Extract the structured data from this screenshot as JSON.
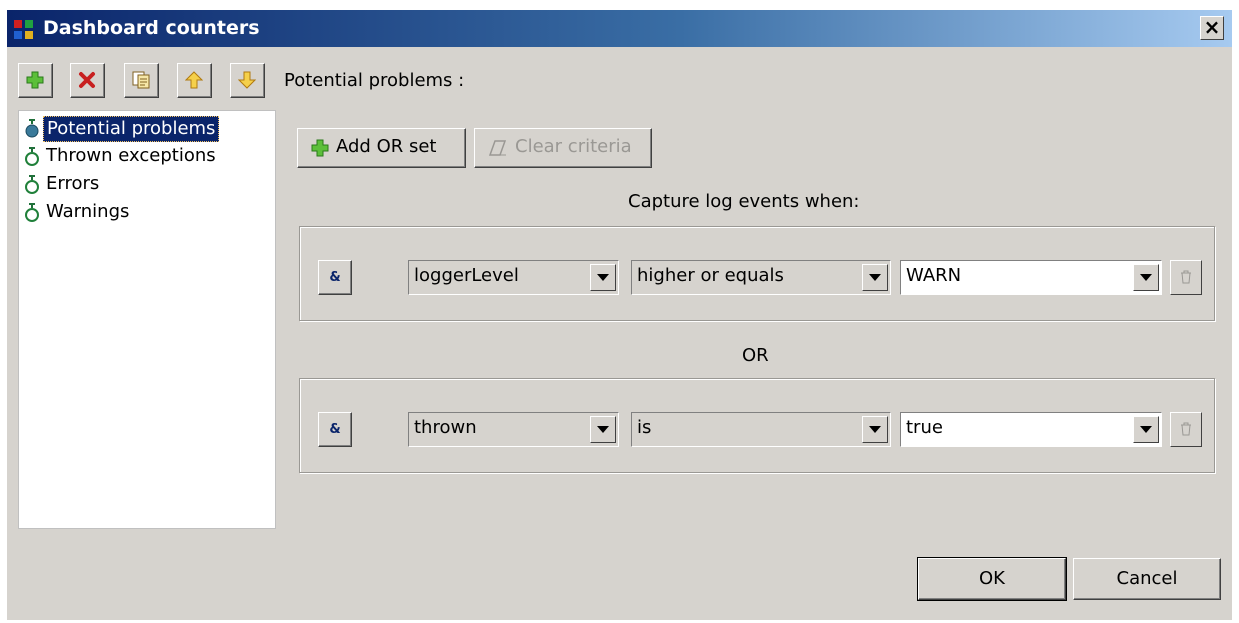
{
  "window": {
    "title": "Dashboard counters",
    "close_glyph": "×"
  },
  "toolbar": {
    "buttons": [
      {
        "name": "add-counter-button",
        "icon": "plus-icon"
      },
      {
        "name": "delete-counter-button",
        "icon": "delete-x-icon"
      },
      {
        "name": "copy-counter-button",
        "icon": "copy-icon"
      },
      {
        "name": "move-up-button",
        "icon": "arrow-up-icon"
      },
      {
        "name": "move-down-button",
        "icon": "arrow-down-icon"
      }
    ],
    "section_label": "Potential problems :"
  },
  "tree": {
    "items": [
      {
        "label": "Potential problems",
        "selected": true
      },
      {
        "label": "Thrown exceptions",
        "selected": false
      },
      {
        "label": "Errors",
        "selected": false
      },
      {
        "label": "Warnings",
        "selected": false
      }
    ]
  },
  "actions": {
    "add_or_set": "Add OR set",
    "clear_criteria": "Clear criteria",
    "clear_disabled": true
  },
  "criteria": {
    "caption": "Capture log events when:",
    "or_label": "OR",
    "and_label": "&",
    "rows": [
      {
        "field": "loggerLevel",
        "operator": "higher or equals",
        "value": "WARN"
      },
      {
        "field": "thrown",
        "operator": "is",
        "value": "true"
      }
    ]
  },
  "footer": {
    "ok": "OK",
    "cancel": "Cancel"
  },
  "colors": {
    "title_start": "#0a246a",
    "title_end": "#a6caf0",
    "dialog_bg": "#d6d3ce",
    "selection": "#0a246a"
  }
}
